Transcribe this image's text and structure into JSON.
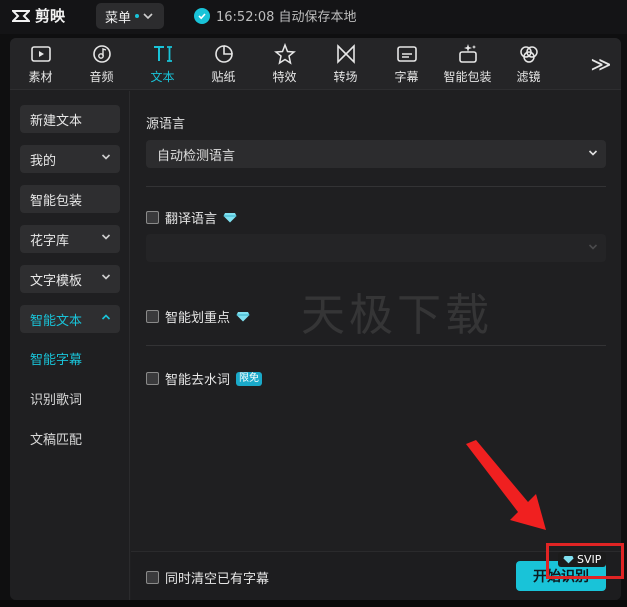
{
  "app": {
    "name": "剪映"
  },
  "topbar": {
    "menu_label": "菜单",
    "save_status": "16:52:08 自动保存本地"
  },
  "toolbar": {
    "tools": [
      {
        "label": "素材",
        "icon": "media-icon"
      },
      {
        "label": "音频",
        "icon": "music-note-icon"
      },
      {
        "label": "文本",
        "icon": "text-icon"
      },
      {
        "label": "贴纸",
        "icon": "sticker-icon"
      },
      {
        "label": "特效",
        "icon": "effects-star-icon"
      },
      {
        "label": "转场",
        "icon": "transition-icon"
      },
      {
        "label": "字幕",
        "icon": "subtitle-icon"
      },
      {
        "label": "智能包装",
        "icon": "smart-pack-icon"
      },
      {
        "label": "滤镜",
        "icon": "filter-icon"
      }
    ],
    "active_index": 2,
    "more_label": "≫"
  },
  "sidebar": {
    "buttons": [
      {
        "label": "新建文本",
        "has_chevron": false
      },
      {
        "label": "我的",
        "has_chevron": true
      },
      {
        "label": "智能包装",
        "has_chevron": false
      },
      {
        "label": "花字库",
        "has_chevron": true
      },
      {
        "label": "文字模板",
        "has_chevron": true
      },
      {
        "label": "智能文本",
        "has_chevron": true
      }
    ],
    "sub_items": [
      {
        "label": "智能字幕",
        "active": true
      },
      {
        "label": "识别歌词",
        "active": false
      },
      {
        "label": "文稿匹配",
        "active": false
      }
    ]
  },
  "content": {
    "source_language_label": "源语言",
    "source_language_value": "自动检测语言",
    "translate_label": "翻译语言",
    "highlight_label": "智能划重点",
    "remove_filler_label": "智能去水词",
    "remove_filler_badge": "限免",
    "watermark": "天极下载",
    "clear_subtitles_label": "同时清空已有字幕",
    "start_button": "开始识别",
    "svip_label": "SVIP"
  },
  "colors": {
    "accent": "#19c3d8",
    "panel": "#1f1f21",
    "highlight_box": "#e02424",
    "arrow": "#f02020"
  }
}
